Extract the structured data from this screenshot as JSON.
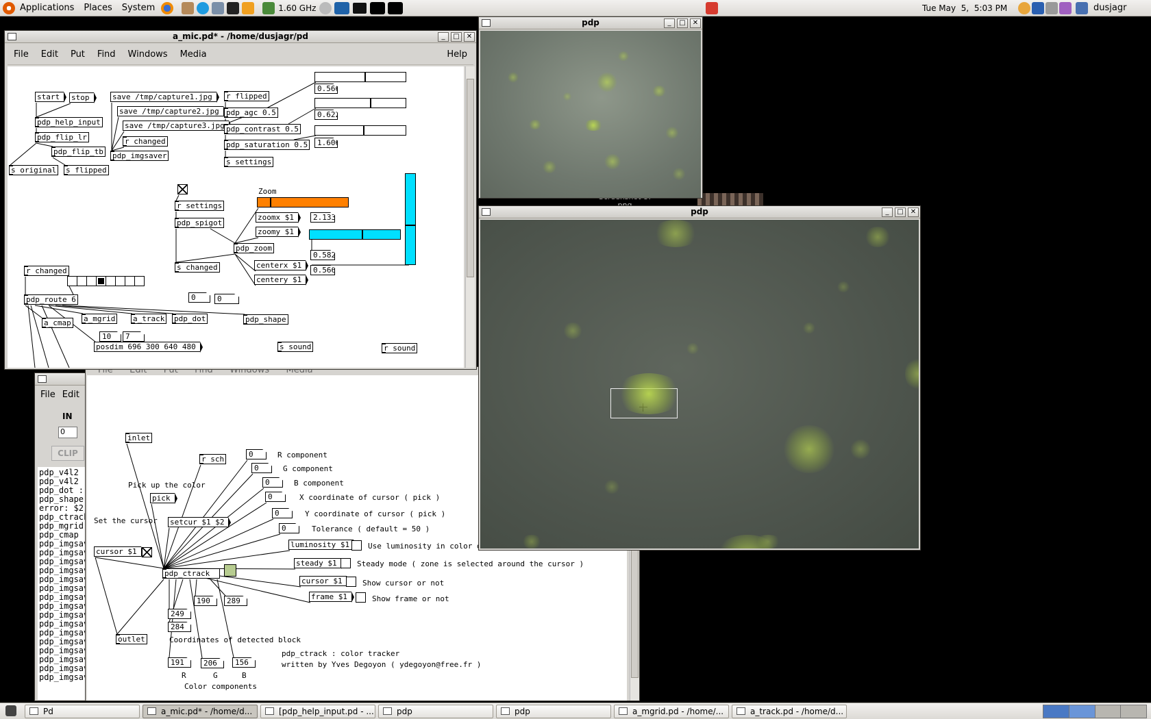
{
  "top_panel": {
    "applications": "Applications",
    "places": "Places",
    "system": "System",
    "cpu": "1.60 GHz",
    "clock": "Tue May  5,  5:03 PM",
    "user": "dusjagr"
  },
  "taskbar": [
    {
      "label": "Pd"
    },
    {
      "label": "a_mic.pd* - /home/d..."
    },
    {
      "label": "[pdp_help_input.pd - ..."
    },
    {
      "label": "pdp"
    },
    {
      "label": "pdp"
    },
    {
      "label": "a_mgrid.pd  - /home/..."
    },
    {
      "label": "a_track.pd  - /home/d..."
    }
  ],
  "main_window": {
    "title": "a_mic.pd* - /home/dusjagr/pd",
    "menu": [
      "File",
      "Edit",
      "Put",
      "Find",
      "Windows",
      "Media"
    ],
    "help": "Help",
    "boxes": {
      "start": "start",
      "stop": "stop",
      "help_input": "pdp_help_input",
      "flip_lr": "pdp_flip_lr",
      "flip_tb": "pdp_flip_tb",
      "s_original": "s original",
      "s_flipped": "s flipped",
      "save1": "save /tmp/capture1.jpg",
      "save2": "save /tmp/capture2.jpg",
      "save3": "save /tmp/capture3.jpg",
      "r_changed1": "r changed",
      "imgsaver": "pdp_imgsaver",
      "r_flipped": "r flipped",
      "agc": "pdp_agc 0.5",
      "contrast": "pdp_contrast 0.5",
      "saturation": "pdp_saturation 0.5",
      "s_settings": "s settings",
      "n_agc": "0.566",
      "n_contrast": "0.622",
      "n_saturation": "1.606",
      "r_settings": "r settings",
      "spigot": "pdp_spigot",
      "zoom_label": "Zoom",
      "zoomx": "zoomx $1",
      "zoomy": "zoomy $1",
      "pdp_zoom": "pdp_zoom",
      "s_changed": "s changed",
      "centerx": "centerx $1",
      "centery": "centery $1",
      "n_zoom": "2.133",
      "n_cx": "0.582",
      "n_cy": "0.566",
      "r_changed2": "r changed",
      "route": "pdp_route 6",
      "n0a": "0",
      "n0b": "0",
      "a_cmap": "a_cmap",
      "a_mgrid": "a_mgrid",
      "a_track": "a_track",
      "pdp_dot": "pdp_dot",
      "pdp_shape": "pdp_shape",
      "n10": "10",
      "n7": "7",
      "posdim": "posdim 696 300 640 480",
      "s_sound": "s sound",
      "r_sound": "r sound"
    }
  },
  "pd_console": {
    "menu": [
      "File",
      "Edit"
    ],
    "in_label": "IN",
    "in_value": "0",
    "clip": "CLIP",
    "lines": [
      "pdp_v4l2 :",
      "pdp_v4l2 :",
      "pdp_dot :",
      "pdp_shape",
      "error: $2",
      "pdp_ctrack",
      "pdp_mgrid",
      "pdp_cmap :",
      "pdp_imgsav",
      "pdp_imgsav",
      "pdp_imgsav",
      "pdp_imgsav",
      "pdp_imgsav",
      "pdp_imgsav",
      "pdp_imgsav",
      "pdp_imgsav",
      "pdp_imgsav",
      "pdp_imgsav",
      "pdp_imgsav",
      "pdp_imgsav",
      "pdp_imgsav",
      "pdp_imgsav",
      "pdp_imgsav",
      "pdp_imgsav"
    ]
  },
  "ctrack_window": {
    "menu": [
      "File",
      "Edit",
      "Put",
      "Find",
      "Windows",
      "Media"
    ],
    "inlet": "inlet",
    "r_sch": "r sch",
    "pick_comment": "Pick up the color",
    "pick": "pick",
    "set_cursor": "Set the cursor",
    "setcur": "setcur $1 $2",
    "cursor1": "cursor $1",
    "ctrack": "pdp_ctrack",
    "outlet": "outlet",
    "r_comp": "R component",
    "g_comp": "G component",
    "b_comp": "B component",
    "x_coord": "X coordinate of cursor ( pick )",
    "y_coord": "Y coordinate of cursor ( pick )",
    "tolerance": "Tolerance ( default = 50 )",
    "luminosity": "luminosity $1",
    "lum_comment": "Use luminosity in color detection",
    "steady": "steady $1",
    "steady_comment": "Steady mode ( zone is selected around the cursor )",
    "cursor2": "cursor $1",
    "cursor_comment": "Show cursor or not",
    "frame": "frame $1",
    "frame_comment": "Show frame or not",
    "zero": "0",
    "n190": "190",
    "n289": "289",
    "n249": "249",
    "n284": "284",
    "coords": "Coordinates of detected block",
    "about1": "pdp_ctrack : color tracker",
    "about2": "written by Yves Degoyon ( ydegoyon@free.fr )",
    "n191": "191",
    "n206": "206",
    "n156": "156",
    "lr": "R",
    "lg": "G",
    "lb": "B",
    "color_comps": "Color components",
    "bg_title": "File   Edit   Put   Find   Windows   Media"
  },
  "pdp_small": {
    "title": "pdp"
  },
  "pdp_large": {
    "title": "pdp"
  },
  "desktop_icon": {
    "label1": "Screenshot-5.",
    "label2": "png"
  },
  "colors": {
    "zoom_slider": "#ff8000",
    "cyan": "#00e0ff",
    "track_box": "#b7cc90"
  }
}
